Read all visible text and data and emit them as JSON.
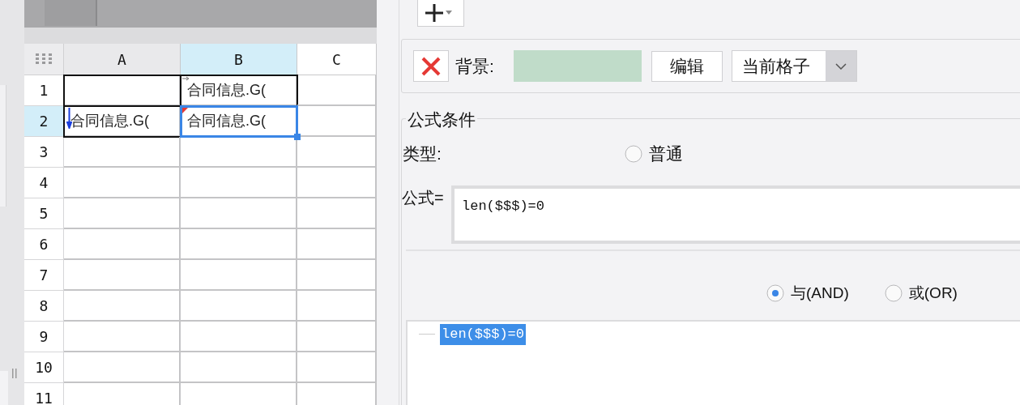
{
  "sheet": {
    "columns": [
      {
        "label": "A",
        "selected": false
      },
      {
        "label": "B",
        "selected": true
      },
      {
        "label": "C",
        "selected": false
      }
    ],
    "rows": [
      {
        "label": "1",
        "selected": false,
        "cells": [
          {
            "text": "",
            "selected": false,
            "outlined": true
          },
          {
            "text": "合同信息.G(",
            "selected": false,
            "outlined": true,
            "kind": "right"
          },
          {
            "text": "",
            "selected": false,
            "outlined": false
          }
        ]
      },
      {
        "label": "2",
        "selected": true,
        "cells": [
          {
            "text": "合同信息.G(",
            "selected": false,
            "outlined": true,
            "kind": "down"
          },
          {
            "text": "合同信息.G(",
            "selected": true,
            "kind": "corner"
          },
          {
            "text": "",
            "selected": false,
            "outlined": false
          }
        ]
      },
      {
        "label": "3",
        "selected": false,
        "cells": []
      },
      {
        "label": "4",
        "selected": false,
        "cells": []
      },
      {
        "label": "5",
        "selected": false,
        "cells": []
      },
      {
        "label": "6",
        "selected": false,
        "cells": []
      },
      {
        "label": "7",
        "selected": false,
        "cells": []
      },
      {
        "label": "8",
        "selected": false,
        "cells": []
      },
      {
        "label": "9",
        "selected": false,
        "cells": []
      },
      {
        "label": "10",
        "selected": false,
        "cells": []
      },
      {
        "label": "11",
        "selected": false,
        "cells": []
      }
    ]
  },
  "background": {
    "label": "背景:",
    "color": "#c0dcc9",
    "edit_button": "编辑",
    "scope": "当前格子"
  },
  "formula_condition": {
    "title": "公式条件",
    "type_label": "类型:",
    "type_options": [
      {
        "label": "普通",
        "selected": false
      }
    ],
    "formula_label": "公式=",
    "formula": "len($$$)=0",
    "logic": [
      {
        "label": "与(AND)",
        "selected": true
      },
      {
        "label": "或(OR)",
        "selected": false
      }
    ],
    "tree": [
      {
        "label": "len($$$)=0",
        "selected": true
      }
    ]
  }
}
